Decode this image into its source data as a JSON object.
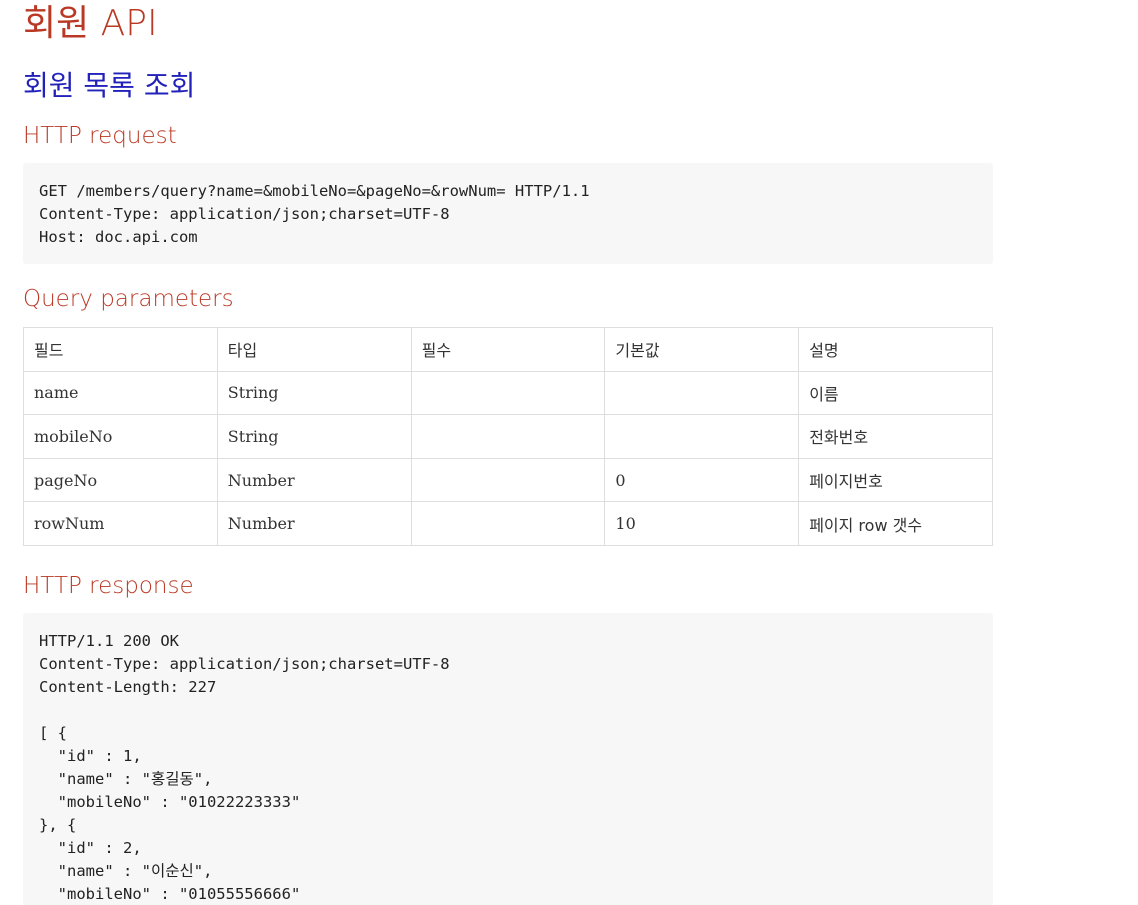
{
  "doc": {
    "title": "회원 API",
    "section_title": "회원 목록 조회",
    "request": {
      "heading": "HTTP request",
      "code": "GET /members/query?name=&mobileNo=&pageNo=&rowNum= HTTP/1.1\nContent-Type: application/json;charset=UTF-8\nHost: doc.api.com"
    },
    "params": {
      "heading": "Query parameters",
      "headers": [
        "필드",
        "타입",
        "필수",
        "기본값",
        "설명"
      ],
      "rows": [
        [
          "name",
          "String",
          "",
          "",
          "이름"
        ],
        [
          "mobileNo",
          "String",
          "",
          "",
          "전화번호"
        ],
        [
          "pageNo",
          "Number",
          "",
          "0",
          "페이지번호"
        ],
        [
          "rowNum",
          "Number",
          "",
          "10",
          "페이지 row 갯수"
        ]
      ]
    },
    "response": {
      "heading": "HTTP response",
      "code": "HTTP/1.1 200 OK\nContent-Type: application/json;charset=UTF-8\nContent-Length: 227\n\n[ {\n  \"id\" : 1,\n  \"name\" : \"홍길동\",\n  \"mobileNo\" : \"01022223333\"\n}, {\n  \"id\" : 2,\n  \"name\" : \"이순신\",\n  \"mobileNo\" : \"01055556666\""
    }
  },
  "colors": {
    "heading": "#ba3925",
    "section": "#2222bb",
    "code_bg": "#f7f7f8",
    "border": "#dedede"
  }
}
